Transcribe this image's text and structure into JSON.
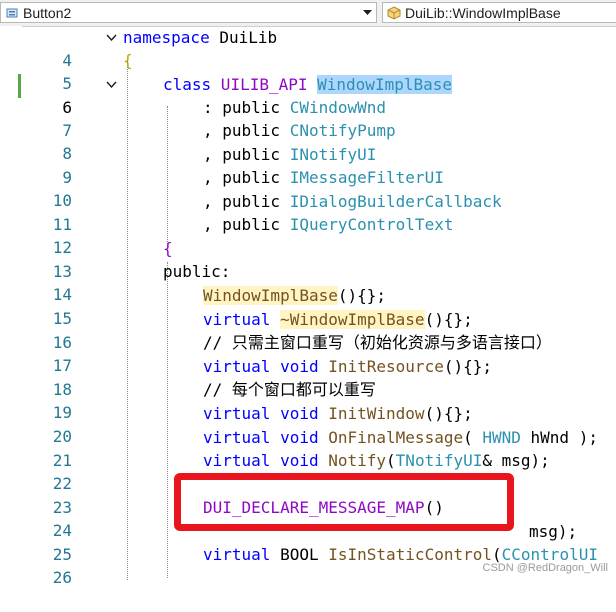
{
  "toolbar": {
    "left_combo": "Button2",
    "right_combo": "DuiLib::WindowImplBase"
  },
  "lines": [
    {
      "n": "4",
      "parts": [
        "namespace",
        " DuiLib"
      ]
    },
    {
      "n": "5",
      "parts": [
        "{"
      ]
    },
    {
      "n": "6",
      "parts": [
        "class",
        " UILIB_API ",
        "WindowImplBase"
      ]
    },
    {
      "n": "7",
      "parts": [
        ": public ",
        "CWindowWnd"
      ]
    },
    {
      "n": "8",
      "parts": [
        ", public ",
        "CNotifyPump"
      ]
    },
    {
      "n": "9",
      "parts": [
        ", public ",
        "INotifyUI"
      ]
    },
    {
      "n": "10",
      "parts": [
        ", public ",
        "IMessageFilterUI"
      ]
    },
    {
      "n": "11",
      "parts": [
        ", public ",
        "IDialogBuilderCallback"
      ]
    },
    {
      "n": "12",
      "parts": [
        ", public ",
        "IQueryControlText"
      ]
    },
    {
      "n": "13",
      "parts": [
        "{"
      ]
    },
    {
      "n": "14",
      "parts": [
        "public:"
      ]
    },
    {
      "n": "15",
      "parts": [
        "WindowImplBase",
        "(){};"
      ]
    },
    {
      "n": "16",
      "parts": [
        "virtual ",
        "~WindowImplBase",
        "(){};"
      ]
    },
    {
      "n": "17",
      "parts": [
        "// 只需主窗口重写（初始化资源与多语言接口）"
      ]
    },
    {
      "n": "18",
      "parts": [
        "virtual void ",
        "InitResource",
        "(){};"
      ]
    },
    {
      "n": "19",
      "parts": [
        "// 每个窗口都可以重写"
      ]
    },
    {
      "n": "20",
      "parts": [
        "virtual void ",
        "InitWindow",
        "(){};"
      ]
    },
    {
      "n": "21",
      "parts": [
        "virtual void ",
        "OnFinalMessage",
        "( ",
        "HWND",
        " hWnd );"
      ]
    },
    {
      "n": "22",
      "parts": [
        "virtual void ",
        "Notify",
        "(",
        "TNotifyUI",
        "& msg);"
      ]
    },
    {
      "n": "23",
      "parts": [
        ""
      ]
    },
    {
      "n": "24",
      "parts": [
        "DUI_DECLARE_MESSAGE_MAP",
        "()"
      ]
    },
    {
      "n": "25",
      "parts": [
        "msg);"
      ]
    },
    {
      "n": "26",
      "parts": [
        "virtual ",
        "BOOL ",
        "IsInStaticControl",
        "(",
        "CControlUI"
      ]
    }
  ],
  "watermark": "CSDN @RedDragon_Will"
}
